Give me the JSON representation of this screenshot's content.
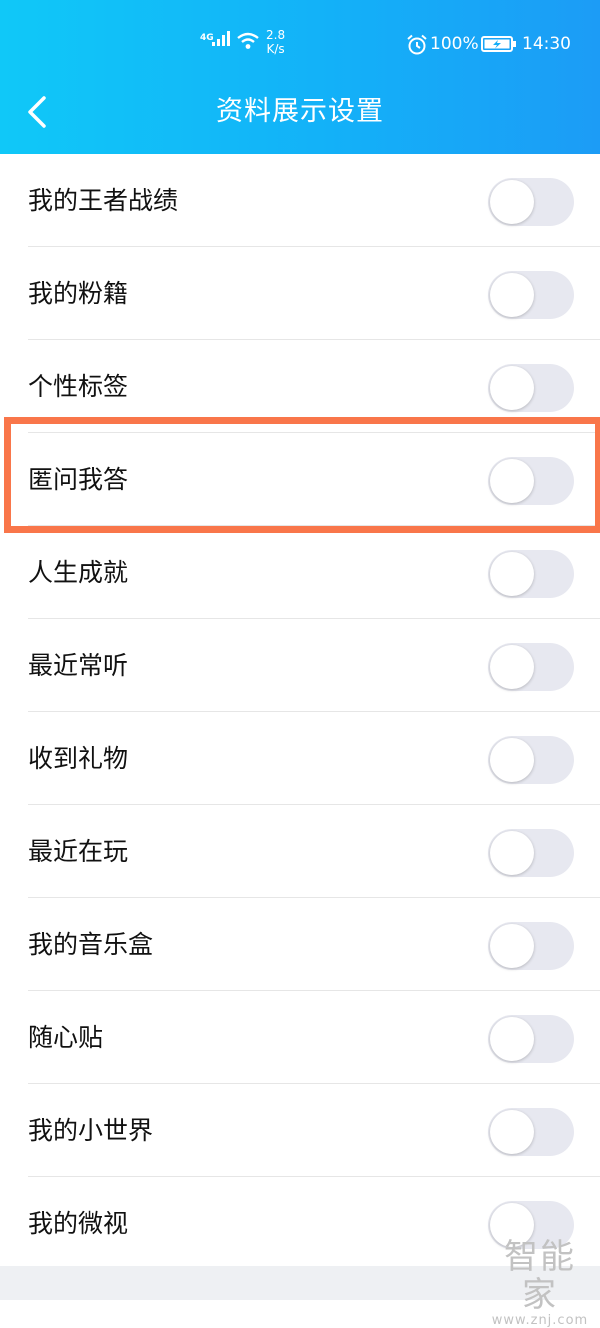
{
  "status_bar": {
    "network": "4G",
    "speed_value": "2.8",
    "speed_unit": "K/s",
    "battery_percent": "100%",
    "time": "14:30"
  },
  "header": {
    "title": "资料展示设置",
    "back_icon": "chevron-left-icon"
  },
  "items": [
    {
      "label": "我的王者战绩",
      "enabled": false
    },
    {
      "label": "我的粉籍",
      "enabled": false
    },
    {
      "label": "个性标签",
      "enabled": false
    },
    {
      "label": "匿问我答",
      "enabled": false,
      "highlighted": true
    },
    {
      "label": "人生成就",
      "enabled": false
    },
    {
      "label": "最近常听",
      "enabled": false
    },
    {
      "label": "收到礼物",
      "enabled": false
    },
    {
      "label": "最近在玩",
      "enabled": false
    },
    {
      "label": "我的音乐盒",
      "enabled": false
    },
    {
      "label": "随心贴",
      "enabled": false
    },
    {
      "label": "我的小世界",
      "enabled": false
    },
    {
      "label": "我的微视",
      "enabled": false
    }
  ],
  "watermark": {
    "main": "智能家",
    "sub": "www.znj.com"
  },
  "colors": {
    "header_start": "#10c8f8",
    "header_end": "#1c9cf6",
    "highlight_border": "#f9764a",
    "toggle_off_track": "#e7e8f0"
  }
}
